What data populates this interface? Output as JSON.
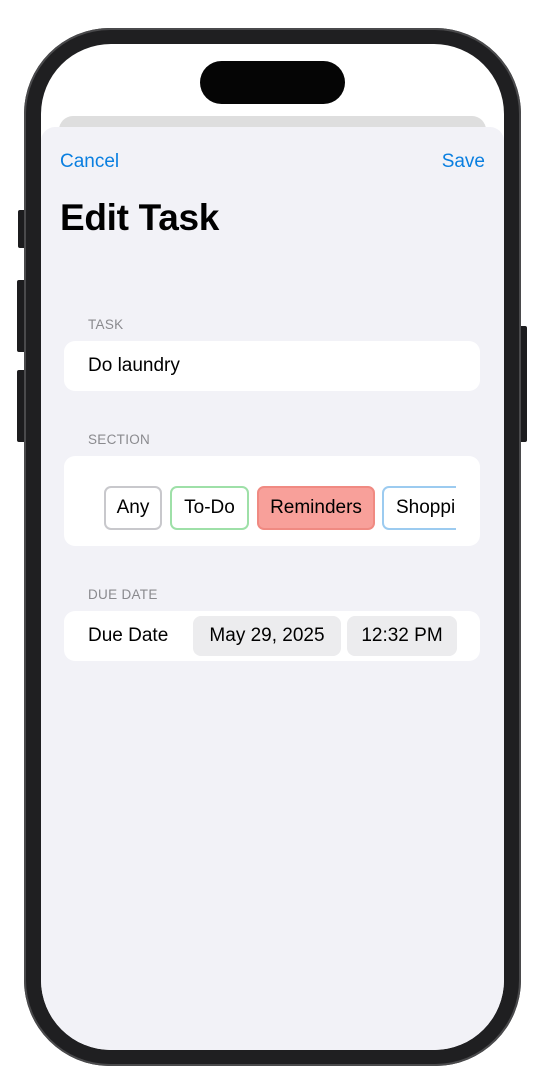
{
  "nav": {
    "cancel_label": "Cancel",
    "save_label": "Save"
  },
  "page": {
    "title": "Edit Task"
  },
  "task": {
    "section_label": "TASK",
    "value": "Do laundry"
  },
  "section": {
    "section_label": "SECTION",
    "chips": [
      {
        "label": "Any",
        "selected": false,
        "border_color": "#c8c8cc"
      },
      {
        "label": "To-Do",
        "selected": false,
        "border_color": "#9ee0a8"
      },
      {
        "label": "Reminders",
        "selected": true,
        "border_color": "#f08a82",
        "fill_color": "#f8a09a"
      },
      {
        "label": "Shoppi",
        "selected": false,
        "border_color": "#9ccbf0"
      }
    ]
  },
  "due_date": {
    "section_label": "DUE DATE",
    "row_label": "Due Date",
    "date": "May 29, 2025",
    "time": "12:32 PM"
  },
  "colors": {
    "accent": "#0a7fe0",
    "sheet_background": "#f2f2f7"
  }
}
